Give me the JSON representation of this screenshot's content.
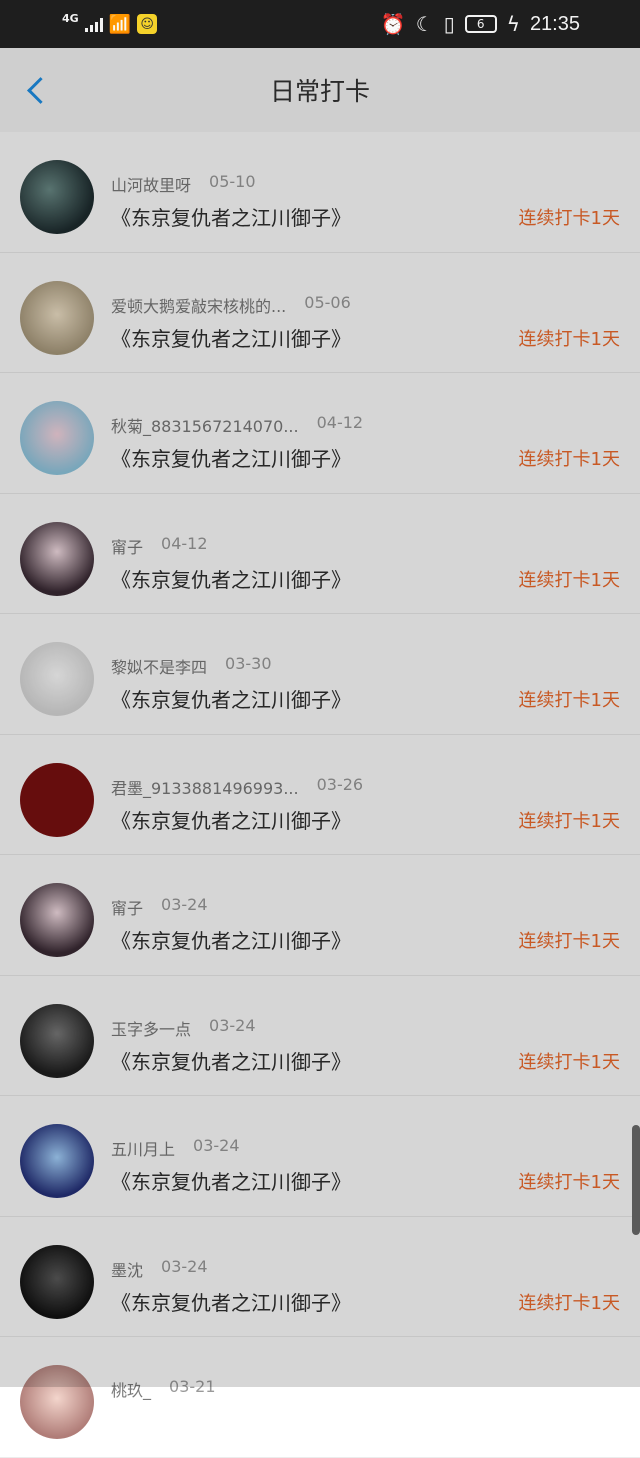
{
  "status_bar": {
    "network": "4G",
    "battery": "6",
    "time": "21:35",
    "icons": [
      "signal-icon",
      "wifi-icon",
      "app-notification-icon",
      "alarm-icon",
      "moon-icon",
      "vibrate-icon",
      "battery-icon",
      "charging-icon"
    ]
  },
  "header": {
    "title": "日常打卡"
  },
  "list": {
    "items": [
      {
        "name": "山河故里呀",
        "date": "05-10",
        "book": "《东京复仇者之江川御子》",
        "streak": "连续打卡1天"
      },
      {
        "name": "爱顿大鹅爱敲宋核桃的...",
        "date": "05-06",
        "book": "《东京复仇者之江川御子》",
        "streak": "连续打卡1天"
      },
      {
        "name": "秋菊_8831567214070...",
        "date": "04-12",
        "book": "《东京复仇者之江川御子》",
        "streak": "连续打卡1天"
      },
      {
        "name": "甯子",
        "date": "04-12",
        "book": "《东京复仇者之江川御子》",
        "streak": "连续打卡1天"
      },
      {
        "name": "黎姒不是李四",
        "date": "03-30",
        "book": "《东京复仇者之江川御子》",
        "streak": "连续打卡1天"
      },
      {
        "name": "君墨_9133881496993...",
        "date": "03-26",
        "book": "《东京复仇者之江川御子》",
        "streak": "连续打卡1天"
      },
      {
        "name": "甯子",
        "date": "03-24",
        "book": "《东京复仇者之江川御子》",
        "streak": "连续打卡1天"
      },
      {
        "name": "玉字多一点",
        "date": "03-24",
        "book": "《东京复仇者之江川御子》",
        "streak": "连续打卡1天"
      },
      {
        "name": "五川月上",
        "date": "03-24",
        "book": "《东京复仇者之江川御子》",
        "streak": "连续打卡1天"
      },
      {
        "name": "墨沈",
        "date": "03-24",
        "book": "《东京复仇者之江川御子》",
        "streak": "连续打卡1天"
      },
      {
        "name": "桃玖_",
        "date": "03-21",
        "book": "",
        "streak": ""
      }
    ]
  }
}
